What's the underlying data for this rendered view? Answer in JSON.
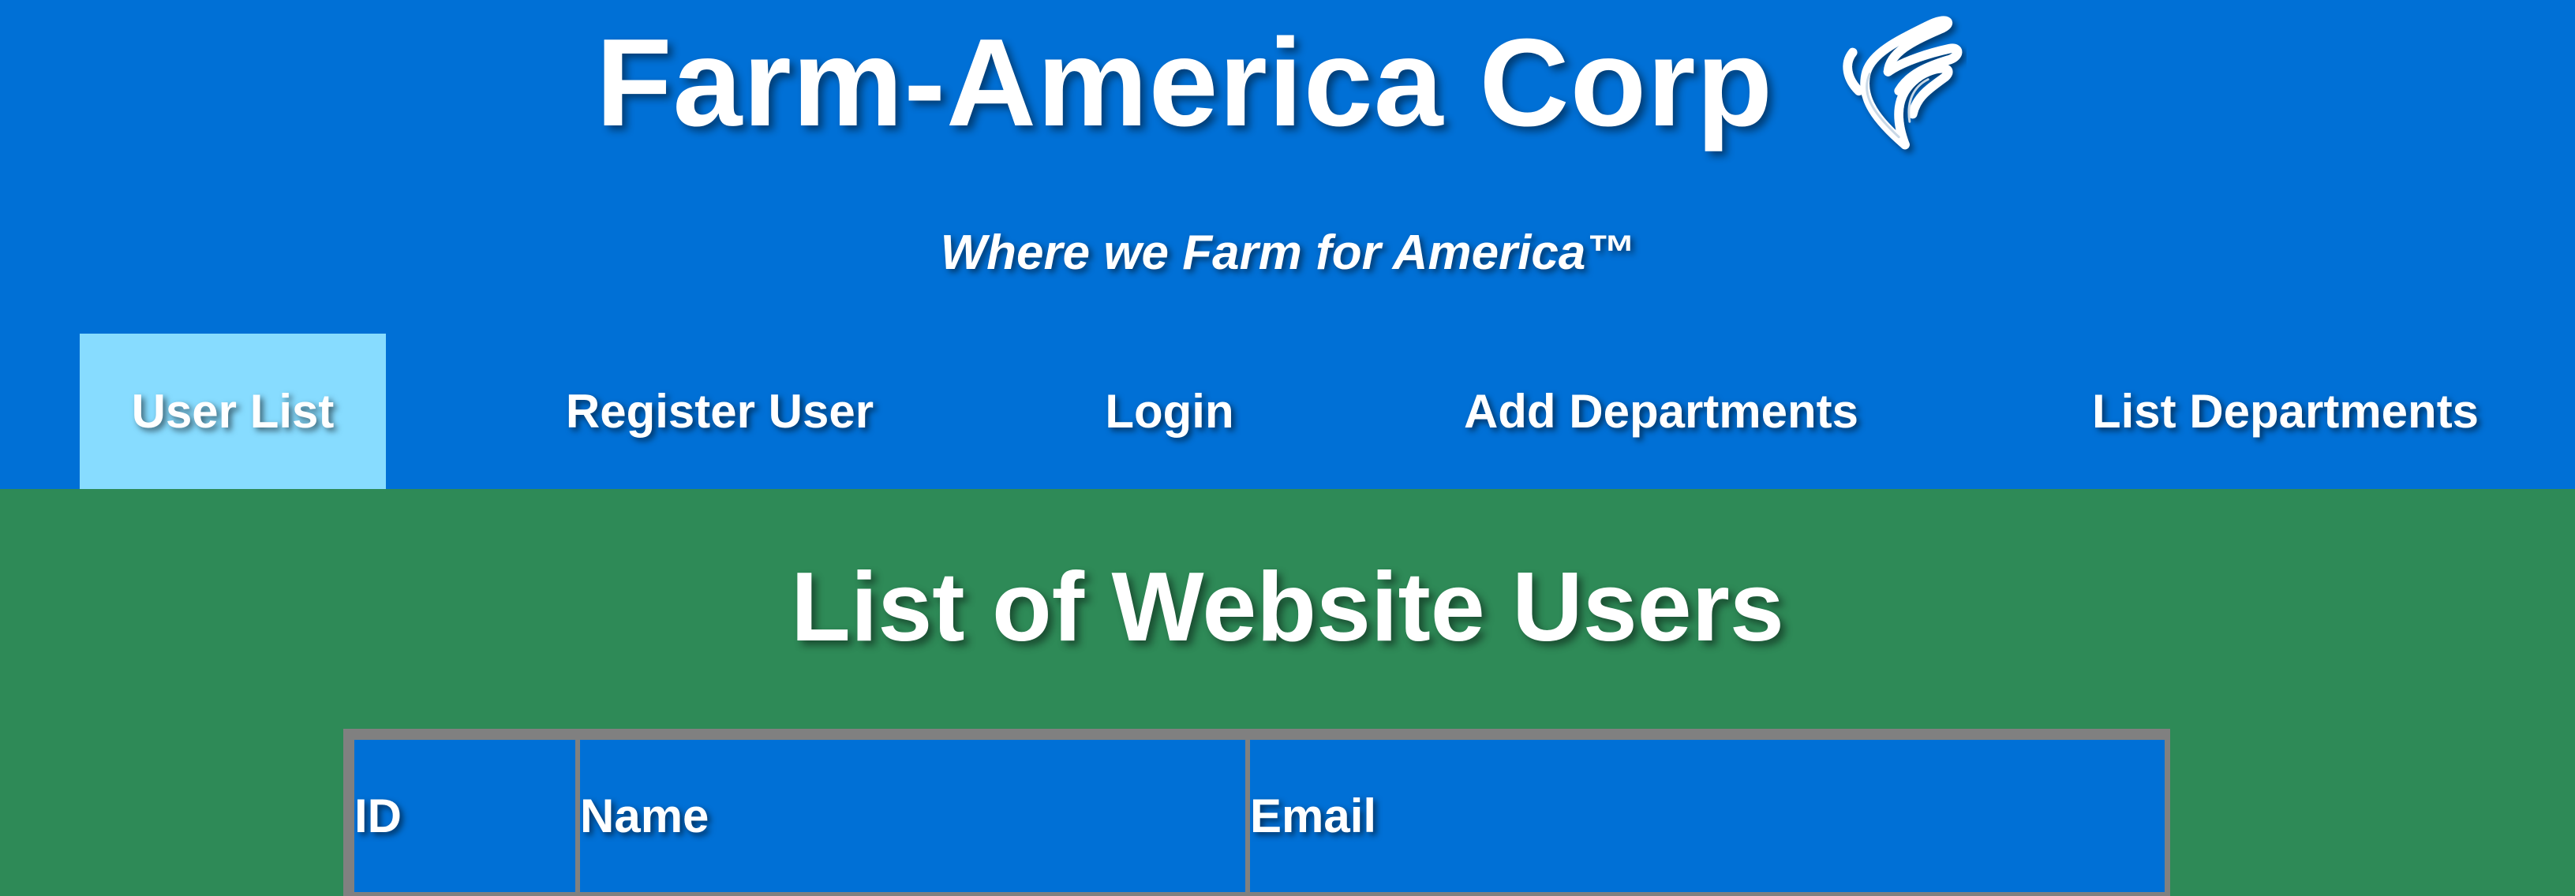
{
  "header": {
    "title": "Farm-America Corp",
    "logo_icon": "wheat-leaf-icon",
    "tagline": "Where we Farm for America™",
    "background_color": "#0070d6"
  },
  "nav": {
    "items": [
      {
        "label": "User List",
        "active": true
      },
      {
        "label": "Register User",
        "active": false
      },
      {
        "label": "Login",
        "active": false
      },
      {
        "label": "Add Departments",
        "active": false
      },
      {
        "label": "List Departments",
        "active": false
      }
    ],
    "active_color": "#87dcff"
  },
  "main": {
    "title": "List of Website Users",
    "background_color": "#2e8a57",
    "table": {
      "columns": [
        "ID",
        "Name",
        "Email"
      ],
      "header_color": "#0070d6",
      "border_color": "#808080"
    }
  }
}
